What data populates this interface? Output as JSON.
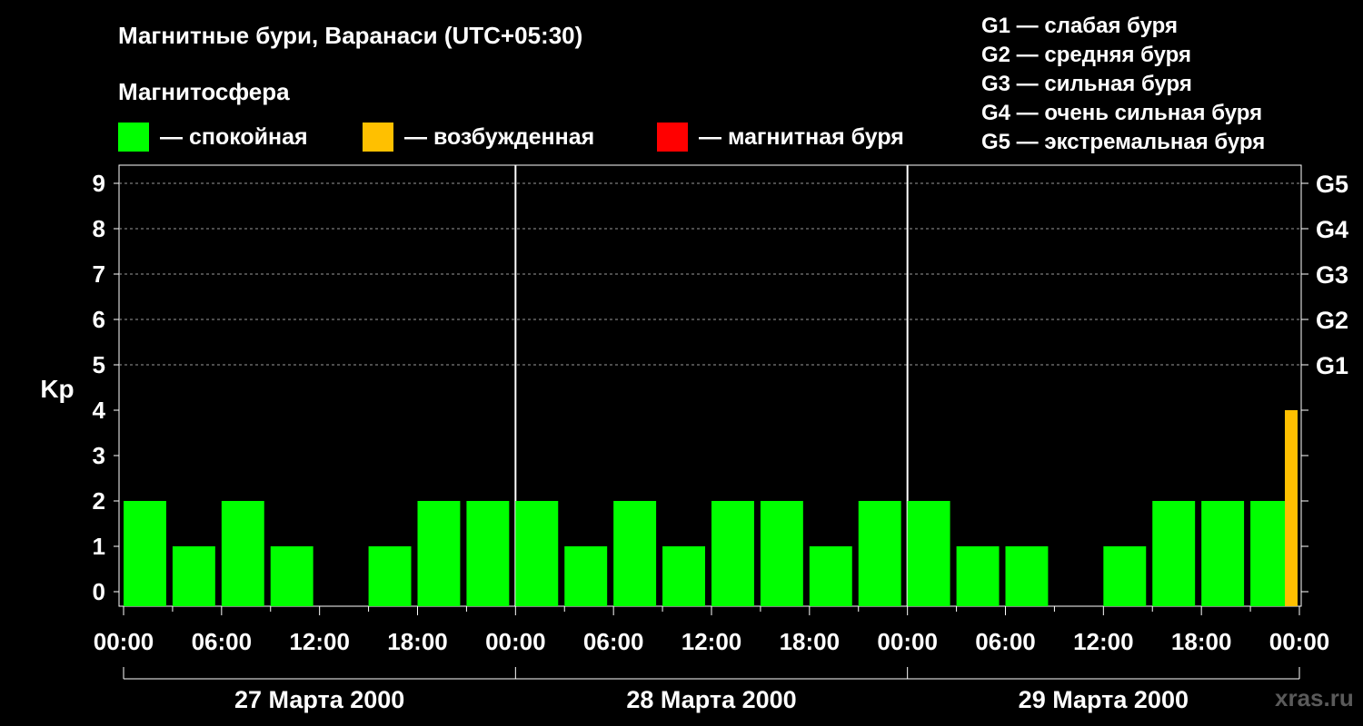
{
  "title": "Магнитные бури, Варанаси (UTC+05:30)",
  "subtitle": "Магнитосфера",
  "legend": [
    {
      "label": "— спокойная",
      "color": "#00ff00"
    },
    {
      "label": "— возбужденная",
      "color": "#ffc000"
    },
    {
      "label": "— магнитная буря",
      "color": "#ff0000"
    }
  ],
  "storm_scale": [
    "G1 — слабая буря",
    "G2 — средняя буря",
    "G3 — сильная буря",
    "G4 — очень сильная буря",
    "G5 — экстремальная буря"
  ],
  "watermark": "xras.ru",
  "chart_data": {
    "type": "bar",
    "ylabel": "Kp",
    "ylim": [
      0,
      9
    ],
    "yticks": [
      0,
      1,
      2,
      3,
      4,
      5,
      6,
      7,
      8,
      9
    ],
    "right_axis": [
      {
        "kp": 5,
        "label": "G1"
      },
      {
        "kp": 6,
        "label": "G2"
      },
      {
        "kp": 7,
        "label": "G3"
      },
      {
        "kp": 8,
        "label": "G4"
      },
      {
        "kp": 9,
        "label": "G5"
      }
    ],
    "grid": "horizontal dashed at 5–9",
    "xtick_labels": [
      "00:00",
      "06:00",
      "12:00",
      "18:00",
      "00:00",
      "06:00",
      "12:00",
      "18:00",
      "00:00",
      "06:00",
      "12:00",
      "18:00",
      "00:00"
    ],
    "days": [
      "27 Марта 2000",
      "28 Марта 2000",
      "29 Марта 2000"
    ],
    "interval_hours": 3,
    "values": [
      2,
      1,
      2,
      1,
      0,
      1,
      2,
      2,
      2,
      1,
      2,
      1,
      2,
      2,
      1,
      2,
      2,
      1,
      1,
      0,
      1,
      2,
      2,
      2,
      4
    ],
    "colors": {
      "quiet": "#00ff00",
      "active": "#ffc000",
      "storm": "#ff0000"
    }
  }
}
